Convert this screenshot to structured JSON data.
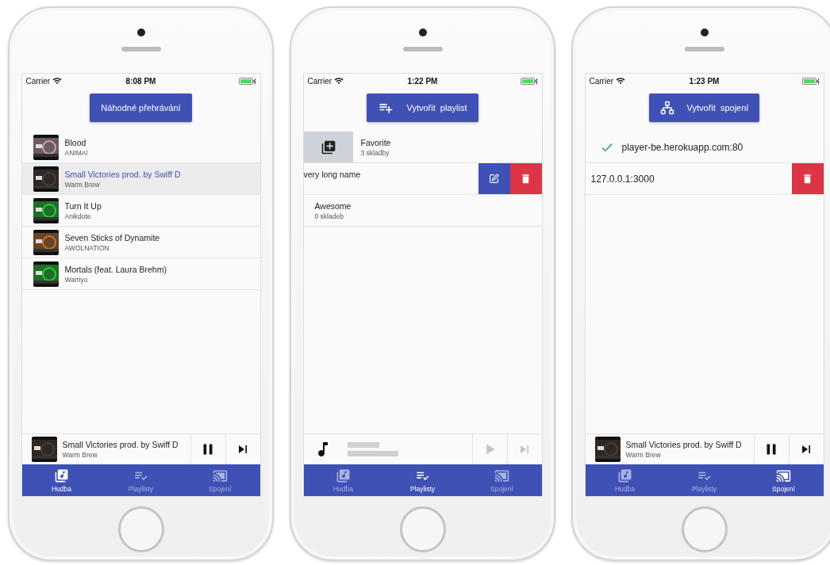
{
  "phones": [
    {
      "kind": "music",
      "status": {
        "carrier": "Carrier",
        "time": "8:08 PM"
      },
      "action": {
        "label": "Náhodné přehrávání"
      },
      "items": [
        {
          "title": "Blood",
          "subtitle": "ANIMA!",
          "selected": false
        },
        {
          "title": "Small Victories prod. by Swiff D",
          "subtitle": "Warm Brew",
          "selected": true
        },
        {
          "title": "Turn It Up",
          "subtitle": "Anikdote",
          "selected": false
        },
        {
          "title": "Seven Sticks of Dynamite",
          "subtitle": "AWOLNATION",
          "selected": false
        },
        {
          "title": "Mortals (feat. Laura Brehm)",
          "subtitle": "Warriyo",
          "selected": false
        }
      ],
      "player": {
        "empty": false,
        "playing": true,
        "title": "Small Victories prod. by Swiff D",
        "artist": "Warm Brew"
      },
      "tabs": [
        {
          "label": "Hudba",
          "selected": true
        },
        {
          "label": "Playlisty",
          "selected": false
        },
        {
          "label": "Spojení",
          "selected": false
        }
      ]
    },
    {
      "kind": "playlists",
      "status": {
        "carrier": "Carrier",
        "time": "1:22 PM"
      },
      "action": {
        "label": "Vytvořit  playlist"
      },
      "items": [
        {
          "title": "Favorite",
          "subtitle": "3 skladby",
          "queue_action": true,
          "edit_action": false,
          "delete_action": false
        },
        {
          "title": "very long name",
          "queue_action": false,
          "edit_action": true,
          "delete_action": true
        },
        {
          "title": "Awesome",
          "subtitle": "0 skladeb",
          "queue_action": false,
          "edit_action": false,
          "delete_action": false
        }
      ],
      "player": {
        "empty": true,
        "playing": false
      },
      "tabs": [
        {
          "label": "Hudba",
          "selected": false
        },
        {
          "label": "Playlisty",
          "selected": true
        },
        {
          "label": "Spojení",
          "selected": false
        }
      ]
    },
    {
      "kind": "connections",
      "status": {
        "carrier": "Carrier",
        "time": "1:23 PM"
      },
      "action": {
        "label": "Vytvořit  spojení"
      },
      "items": [
        {
          "title": "player-be.herokuapp.com:80",
          "connected": true,
          "delete_action": false
        },
        {
          "title": "127.0.0.1:3000",
          "connected": false,
          "delete_action": true
        }
      ],
      "player": {
        "empty": false,
        "playing": true,
        "title": "Small Victories prod. by Swiff D",
        "artist": "Warm Brew"
      },
      "tabs": [
        {
          "label": "Hudba",
          "selected": false
        },
        {
          "label": "Playlisty",
          "selected": false
        },
        {
          "label": "Spojení",
          "selected": true
        }
      ]
    }
  ]
}
